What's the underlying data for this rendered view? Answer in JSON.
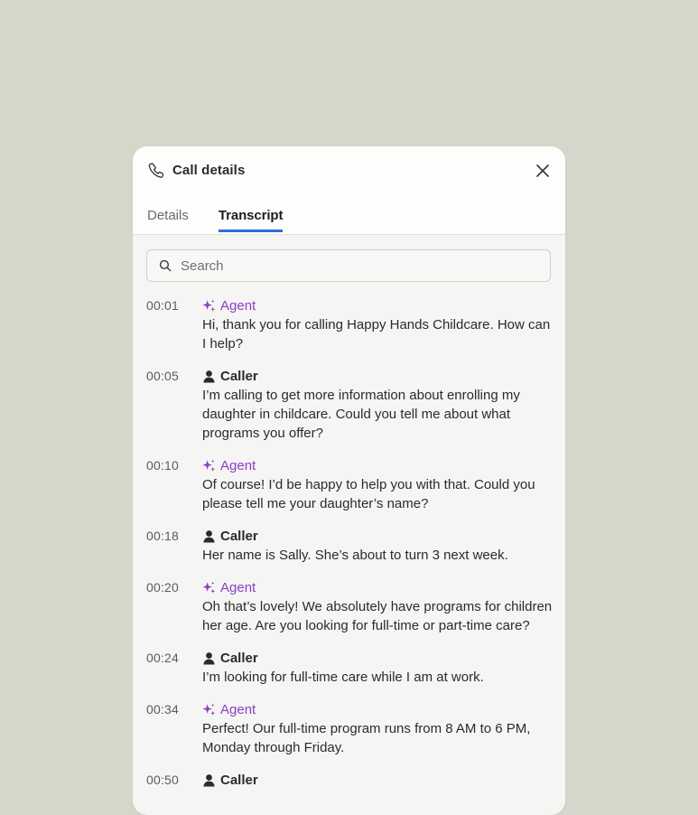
{
  "header": {
    "title": "Call details",
    "icon": "phone-icon",
    "close_icon": "close-icon"
  },
  "tabs": [
    {
      "label": "Details",
      "active": false
    },
    {
      "label": "Transcript",
      "active": true
    }
  ],
  "search": {
    "placeholder": "Search",
    "value": ""
  },
  "colors": {
    "background": "#d6d6cb",
    "agent": "#8a3fc4",
    "tab_underline": "#2a6fd6"
  },
  "transcript": [
    {
      "time": "00:01",
      "speaker": "Agent",
      "role": "agent",
      "text": "Hi, thank you for calling Happy Hands Childcare. How can I help?"
    },
    {
      "time": "00:05",
      "speaker": "Caller",
      "role": "caller",
      "text": "I’m calling to get more information about enrolling my daughter in childcare. Could you tell me about what programs you offer?"
    },
    {
      "time": "00:10",
      "speaker": "Agent",
      "role": "agent",
      "text": "Of course! I’d be happy to help you with that. Could you please tell me your daughter’s name?"
    },
    {
      "time": "00:18",
      "speaker": "Caller",
      "role": "caller",
      "text": "Her name is Sally. She’s about to turn 3 next week."
    },
    {
      "time": "00:20",
      "speaker": "Agent",
      "role": "agent",
      "text": "Oh that’s lovely! We absolutely have programs for children her age. Are you looking for full-time or part-time care?"
    },
    {
      "time": "00:24",
      "speaker": "Caller",
      "role": "caller",
      "text": "I’m looking for full-time care while I am at work."
    },
    {
      "time": "00:34",
      "speaker": "Agent",
      "role": "agent",
      "text": "Perfect! Our full-time program runs from 8 AM to 6 PM, Monday through Friday."
    },
    {
      "time": "00:50",
      "speaker": "Caller",
      "role": "caller",
      "text": ""
    }
  ]
}
